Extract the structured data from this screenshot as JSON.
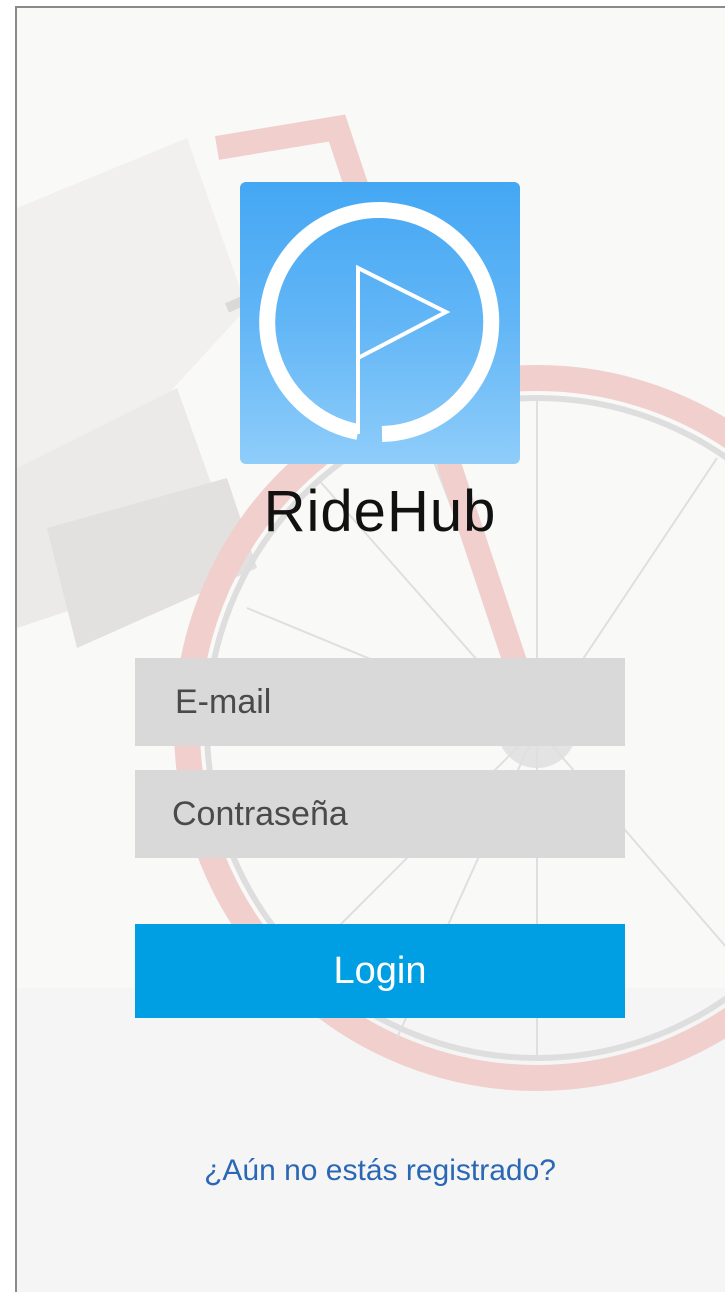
{
  "app": {
    "brand_name": "RideHub",
    "logo_icon": "flag-in-circle-icon",
    "brand_color": "#44a7f3"
  },
  "login_form": {
    "email_placeholder": "E-mail",
    "password_placeholder": "Contraseña",
    "login_label": "Login",
    "login_color": "#009fe3",
    "register_link": "¿Aún no estás registrado?",
    "register_color": "#2a67b5"
  },
  "background": {
    "image": "bicycle-wheel-photo"
  }
}
